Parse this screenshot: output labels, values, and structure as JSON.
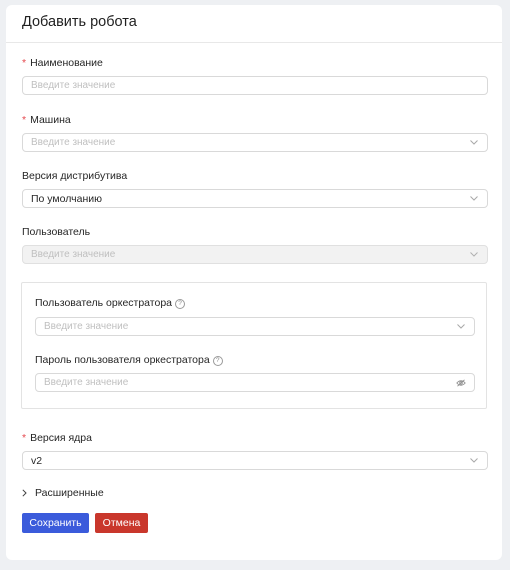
{
  "dialog": {
    "title": "Добавить робота"
  },
  "fields": {
    "name": {
      "label": "Наименование",
      "required_mark": "*",
      "placeholder": "Введите значение"
    },
    "machine": {
      "label": "Машина",
      "required_mark": "*",
      "placeholder": "Введите значение"
    },
    "distro": {
      "label": "Версия дистрибутива",
      "value": "По умолчанию"
    },
    "user": {
      "label": "Пользователь",
      "placeholder": "Введите значение"
    },
    "orch_user": {
      "label": "Пользователь оркестратора",
      "help": "?",
      "placeholder": "Введите значение"
    },
    "orch_password": {
      "label": "Пароль пользователя оркестратора",
      "help": "?",
      "placeholder": "Введите значение"
    },
    "kernel": {
      "label": "Версия ядра",
      "required_mark": "*",
      "value": "v2"
    }
  },
  "advanced": {
    "label": "Расширенные"
  },
  "buttons": {
    "save": "Сохранить",
    "cancel": "Отмена"
  },
  "colors": {
    "primary": "#3b5bdb",
    "danger": "#c9372c",
    "required": "#e5484d"
  }
}
